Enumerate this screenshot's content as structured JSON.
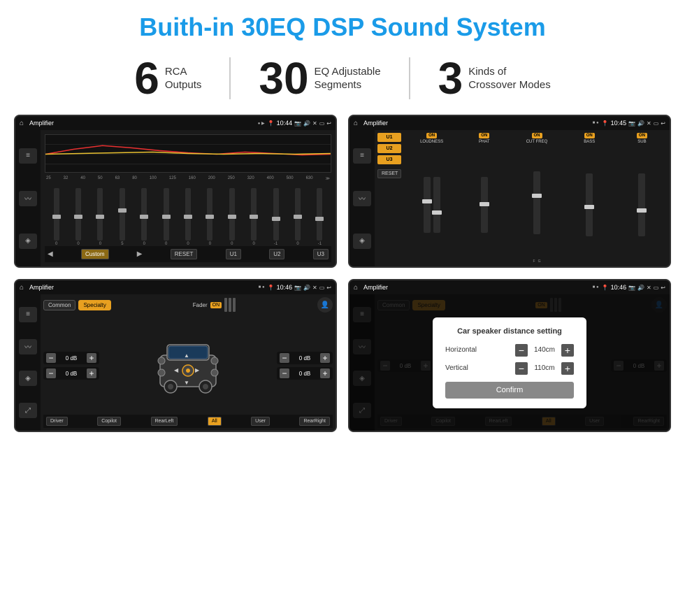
{
  "page": {
    "title": "Buith-in 30EQ DSP Sound System"
  },
  "stats": [
    {
      "number": "6",
      "line1": "RCA",
      "line2": "Outputs"
    },
    {
      "number": "30",
      "line1": "EQ Adjustable",
      "line2": "Segments"
    },
    {
      "number": "3",
      "line1": "Kinds of",
      "line2": "Crossover Modes"
    }
  ],
  "screen1": {
    "title": "Amplifier",
    "time": "10:44",
    "freqs": [
      "25",
      "32",
      "40",
      "50",
      "63",
      "80",
      "100",
      "125",
      "160",
      "200",
      "250",
      "320",
      "400",
      "500",
      "630"
    ],
    "values": [
      "0",
      "0",
      "0",
      "5",
      "0",
      "0",
      "0",
      "0",
      "0",
      "0",
      "-1",
      "0",
      "-1"
    ],
    "bottom_btns": [
      "Custom",
      "RESET",
      "U1",
      "U2",
      "U3"
    ]
  },
  "screen2": {
    "title": "Amplifier",
    "time": "10:45",
    "channels": [
      "U1",
      "U2",
      "U3"
    ],
    "sections": [
      {
        "on": true,
        "label": "LOUDNESS"
      },
      {
        "on": true,
        "label": "PHAT"
      },
      {
        "on": true,
        "label": "CUT FREQ"
      },
      {
        "on": true,
        "label": "BASS"
      },
      {
        "on": true,
        "label": "SUB"
      }
    ],
    "reset_label": "RESET"
  },
  "screen3": {
    "title": "Amplifier",
    "time": "10:46",
    "tabs": [
      "Common",
      "Specialty"
    ],
    "fader_label": "Fader",
    "fader_on": "ON",
    "db_values": [
      "0 dB",
      "0 dB",
      "0 dB",
      "0 dB"
    ],
    "bottom_btns": [
      "Driver",
      "Copilot",
      "RearLeft",
      "All",
      "User",
      "RearRight"
    ]
  },
  "screen4": {
    "title": "Amplifier",
    "time": "10:46",
    "tabs": [
      "Common",
      "Specialty"
    ],
    "dialog": {
      "title": "Car speaker distance setting",
      "horizontal_label": "Horizontal",
      "horizontal_value": "140cm",
      "vertical_label": "Vertical",
      "vertical_value": "110cm",
      "confirm_label": "Confirm"
    },
    "db_values": [
      "0 dB",
      "0 dB"
    ],
    "bottom_btns": [
      "Driver",
      "Copilot",
      "RearLeft",
      "All",
      "User",
      "RearRight"
    ]
  }
}
